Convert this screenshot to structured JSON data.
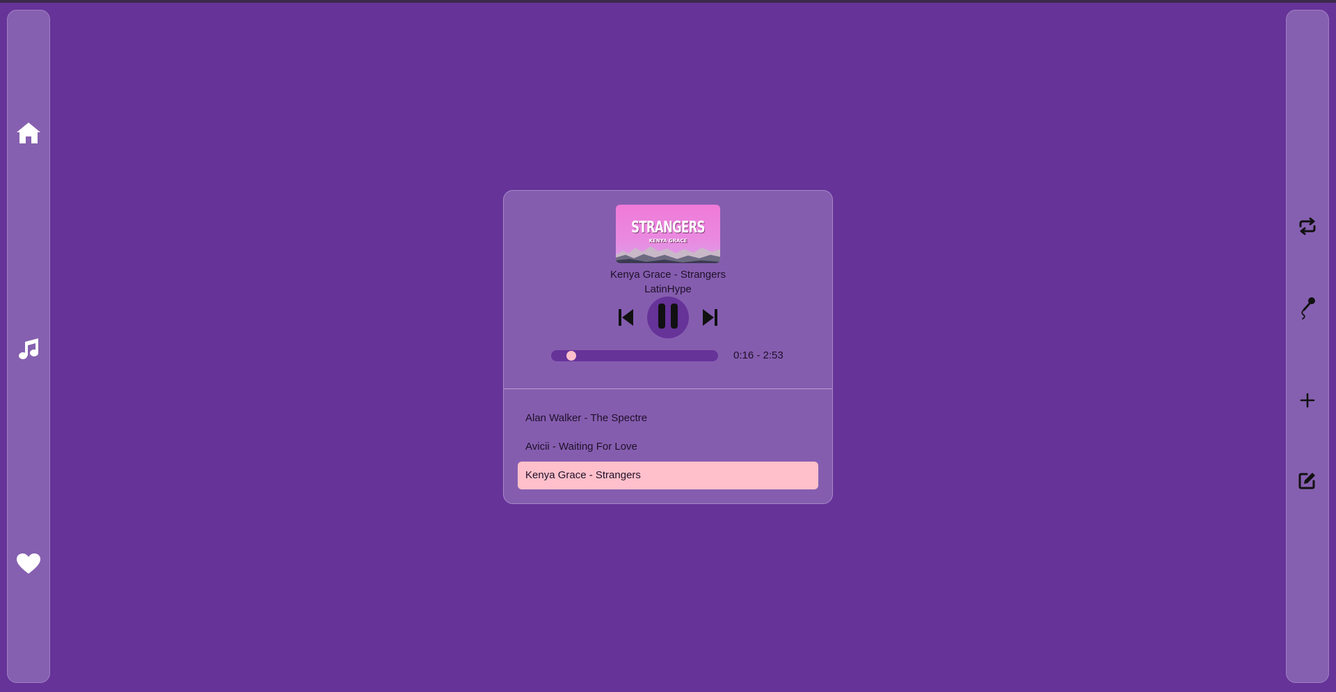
{
  "colors": {
    "background": "#663399",
    "panel": "#855daf",
    "accent": "#ffc0cb",
    "text": "#1e1028",
    "icon_left": "#ffffff",
    "icon_right": "#111111"
  },
  "sidebar_left": {
    "items": [
      {
        "name": "home",
        "icon": "home-icon"
      },
      {
        "name": "music",
        "icon": "music-note-icon"
      },
      {
        "name": "favorites",
        "icon": "heart-icon"
      }
    ]
  },
  "sidebar_right": {
    "items": [
      {
        "name": "repeat",
        "icon": "repeat-icon"
      },
      {
        "name": "microphone",
        "icon": "microphone-icon"
      },
      {
        "name": "add",
        "icon": "plus-icon"
      },
      {
        "name": "edit",
        "icon": "edit-icon"
      }
    ]
  },
  "player": {
    "cover": {
      "title": "STRANGERS",
      "subtitle": "KENYA GRACE"
    },
    "now_playing": {
      "title": "Kenya Grace - Strangers",
      "artist": "LatinHype"
    },
    "controls": {
      "prev_icon": "skip-back-icon",
      "play_icon": "pause-icon",
      "next_icon": "skip-forward-icon"
    },
    "progress": {
      "current": "0:16",
      "total": "2:53",
      "display": "0:16 - 2:53",
      "fraction": 0.092
    },
    "playlist": [
      {
        "title": "Alan Walker - The Spectre",
        "active": false
      },
      {
        "title": "Avicii - Waiting For Love",
        "active": false
      },
      {
        "title": "Kenya Grace - Strangers",
        "active": true
      }
    ]
  }
}
